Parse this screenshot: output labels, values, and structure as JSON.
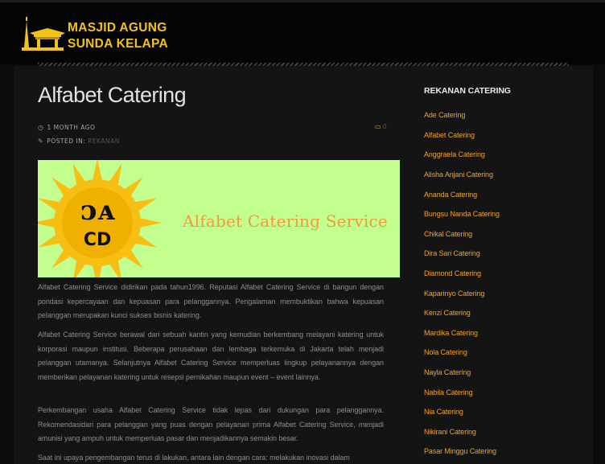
{
  "header": {
    "site_title_line1": "MASJID AGUNG",
    "site_title_line2": "SUNDA KELAPA"
  },
  "post": {
    "title": "Alfabet Catering",
    "date": "1 MONTH AGO",
    "posted_in_label": "POSTED IN:",
    "category": "REKANAN",
    "comment_count": "0",
    "image_text": "Alfabet Catering Service",
    "logo_top": "ᴐᴀ",
    "logo_bottom": "CD",
    "paragraphs": [
      "Alfabet Catering Service didirikan pada tahun1996. Reputasi Alfabet Catering Service di bangun dengan pondasi kepercayaan dan kepuasan para pelanggannya. Pengalaman membuktikan bahwa kepuasan pelanggan merupakan kunci sukses bisnis katering.",
      "Alfabet Catering Service berawal dari sebuah kantin yang kemudian berkembang melayani katering untuk korporasi maupun institusi. Beberapa perusahaan dan lembaga terkemuka di Jakarta telah menjadi pelanggan utamanya. Selanjutnya Alfabet Catering Service memperluas lingkup pelayanannya dengan memberikan pelayanan katering untuk resepsi pernikahan maupun event – event lainnya.",
      "Perkembangan usaha Alfabet Catering Service tidak lepas dari dukungan para pelanggannya. Rekomendasidari para pelanggan yang puas dengan pelayanan prima Alfabet Catering Service, menjadi amunisi yang ampuh untuk memperluas pasar dan menjadikannya semakin besar.",
      "Saat ini upaya pengembangan terus di lakukan, antara lain dengan cara: melakukan inovasi dalam"
    ]
  },
  "sidebar": {
    "title": "REKANAN CATERING",
    "items": [
      "Ade Catering",
      "Alfabet Catering",
      "Anggraela Catering",
      "Alisha Anjani Catering",
      "Ananda Catering",
      "Bungsu Nanda Catering",
      "Chikal Catering",
      "Dira Sari Catering",
      "Diamond Catering",
      "Kaparinyo Catering",
      "Kenzi Catering",
      "Mardika Catering",
      "Nola Catering",
      "Nayla Catering",
      "Nabila Catering",
      "Nia Catering",
      "Nikirani Catering",
      "Pasar Minggu Catering"
    ]
  },
  "colors": {
    "accent": "#f2a428",
    "title_yellow": "#f3c21b",
    "image_bg": "#c2ff8e",
    "sun": "#f7bf14"
  },
  "icons": [
    "mosque-logo-icon",
    "clock-icon",
    "pencil-icon",
    "comment-icon"
  ]
}
